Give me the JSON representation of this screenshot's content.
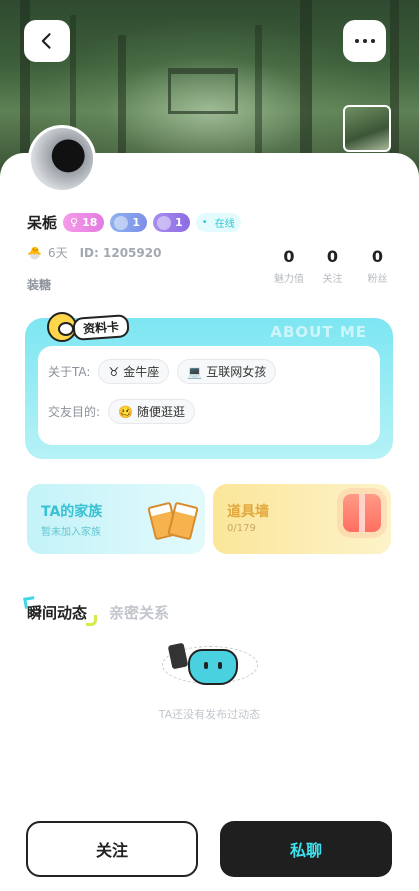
{
  "colors": {
    "accent": "#3dd7e5",
    "online": "#28c7d8",
    "chat_button_text": "#3fe0ee",
    "dark_button": "#1f1f1f"
  },
  "header": {
    "back_icon": "chevron-left-icon",
    "more_icon": "more-dots-icon"
  },
  "profile": {
    "name": "呆栀",
    "gender_age": "18",
    "badge_level_1": "1",
    "badge_level_2": "1",
    "online_label": "在线",
    "days": "6天",
    "id_label": "ID: 1205920",
    "tagline": "装糖"
  },
  "stats": [
    {
      "value": "0",
      "label": "魅力值"
    },
    {
      "value": "0",
      "label": "关注"
    },
    {
      "value": "0",
      "label": "粉丝"
    }
  ],
  "about": {
    "badge_label": "资料卡",
    "watermark": "ABOUT ME",
    "about_ta_label": "关于TA:",
    "zodiac_icon": "♉",
    "zodiac": "金牛座",
    "tag_icon": "💻",
    "tag": "互联网女孩",
    "purpose_label": "交友目的:",
    "purpose_icon": "🥴",
    "purpose": "随便逛逛"
  },
  "family": {
    "title": "TA的家族",
    "subtitle": "暂未加入家族"
  },
  "props": {
    "title": "道具墙",
    "subtitle": "0/179"
  },
  "tabs": [
    {
      "label": "瞬间动态"
    },
    {
      "label": "亲密关系"
    }
  ],
  "empty_text": "TA还没有发布过动态",
  "actions": {
    "follow": "关注",
    "chat": "私聊"
  }
}
